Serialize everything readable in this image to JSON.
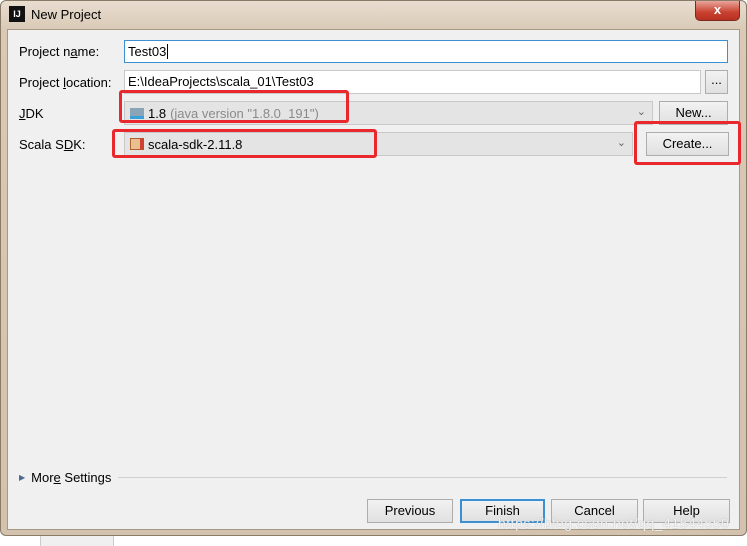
{
  "window": {
    "title": "New Project",
    "close": "x",
    "logo": "IJ"
  },
  "form": {
    "project_name": {
      "label_pre": "Project n",
      "label_ul": "a",
      "label_post": "me:",
      "value": "Test03"
    },
    "project_location": {
      "label_pre": "Project ",
      "label_ul": "l",
      "label_post": "ocation:",
      "value": "E:\\IdeaProjects\\scala_01\\Test03",
      "browse": "..."
    },
    "jdk": {
      "label_ul": "J",
      "label_post": "DK",
      "value": "1.8",
      "detail": "(java version \"1.8.0_191\")",
      "new_button": "New..."
    },
    "scala_sdk": {
      "label_pre": "Scala S",
      "label_ul": "D",
      "label_post": "K:",
      "value": "scala-sdk-2.11.8",
      "create_button": "Create..."
    }
  },
  "more_settings": {
    "pre": "Mor",
    "ul": "e",
    "post": " Settings"
  },
  "buttons": {
    "previous": "Previous",
    "finish": "Finish",
    "cancel": "Cancel",
    "help": "Help"
  },
  "watermark": "https://blog.csdn.net/qq_41544550",
  "highlight_color": "#e8282c"
}
